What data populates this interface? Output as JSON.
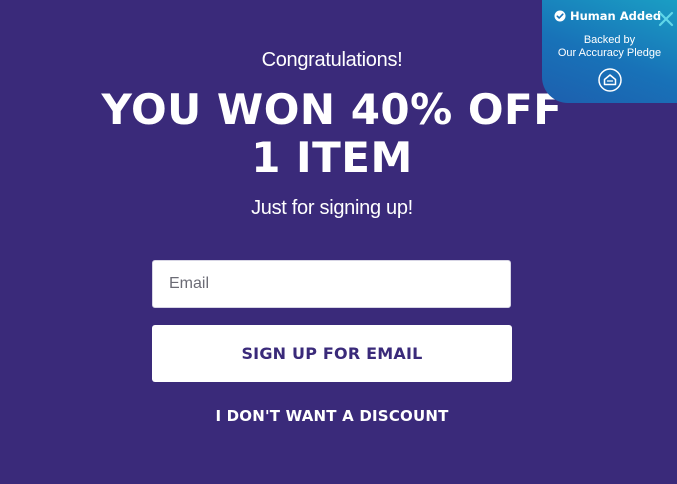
{
  "popup": {
    "congrats": "Congratulations!",
    "headline_line1": "YOU WON 40% OFF",
    "headline_line2": "1 ITEM",
    "subhead": "Just for signing up!",
    "email_placeholder": "Email",
    "signup_label": "SIGN UP FOR EMAIL",
    "no_discount_label": "I DON'T WANT A DISCOUNT"
  },
  "badge": {
    "title": "Human Added",
    "line1": "Backed by",
    "line2": "Our Accuracy Pledge",
    "icons": [
      "check-circle-icon",
      "shield-icon",
      "close-icon"
    ]
  },
  "colors": {
    "background": "#3a2a7a",
    "button_text": "#3a2a7a",
    "badge_gradient_start": "#1a9ec4",
    "badge_gradient_end": "#1d5fae",
    "close_icon": "#5fd6e8"
  }
}
